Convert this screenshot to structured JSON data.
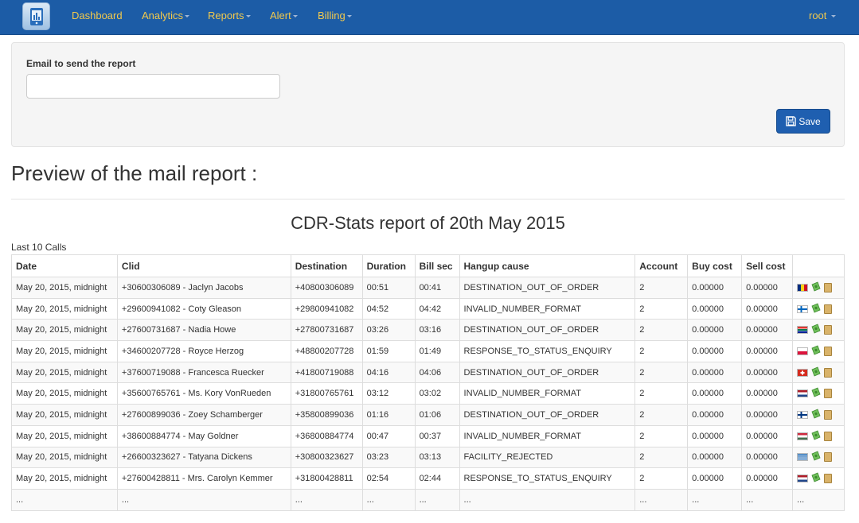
{
  "navbar": {
    "logo_icon": "phone-app-icon",
    "items": [
      {
        "label": "Dashboard",
        "dropdown": false
      },
      {
        "label": "Analytics",
        "dropdown": true
      },
      {
        "label": "Reports",
        "dropdown": true
      },
      {
        "label": "Alert",
        "dropdown": true
      },
      {
        "label": "Billing",
        "dropdown": true
      }
    ],
    "user": "root",
    "colors": {
      "background": "#1c5ca6",
      "link": "#f2c94c"
    }
  },
  "form": {
    "email_label": "Email to send the report",
    "email_value": "",
    "email_placeholder": "",
    "save_label": "Save",
    "save_icon": "floppy-disk-icon"
  },
  "preview_title": "Preview of the mail report :",
  "report": {
    "title": "CDR-Stats report of 20th May 2015",
    "section_label": "Last 10 Calls",
    "columns": [
      "Date",
      "Clid",
      "Destination",
      "Duration",
      "Bill sec",
      "Hangup cause",
      "Account",
      "Buy cost",
      "Sell cost",
      ""
    ],
    "rows": [
      {
        "date": "May 20, 2015, midnight",
        "clid": "+30600306089 - Jaclyn Jacobs",
        "destination": "+40800306089",
        "duration": "00:51",
        "billsec": "00:41",
        "hangup": "DESTINATION_OUT_OF_ORDER",
        "account": "2",
        "buy": "0.00000",
        "sell": "0.00000",
        "flag": "romania-flag"
      },
      {
        "date": "May 20, 2015, midnight",
        "clid": "+29600941082 - Coty Gleason",
        "destination": "+29800941082",
        "duration": "04:52",
        "billsec": "04:42",
        "hangup": "INVALID_NUMBER_FORMAT",
        "account": "2",
        "buy": "0.00000",
        "sell": "0.00000",
        "flag": "faroe-islands-flag"
      },
      {
        "date": "May 20, 2015, midnight",
        "clid": "+27600731687 - Nadia Howe",
        "destination": "+27800731687",
        "duration": "03:26",
        "billsec": "03:16",
        "hangup": "DESTINATION_OUT_OF_ORDER",
        "account": "2",
        "buy": "0.00000",
        "sell": "0.00000",
        "flag": "south-africa-flag"
      },
      {
        "date": "May 20, 2015, midnight",
        "clid": "+34600207728 - Royce Herzog",
        "destination": "+48800207728",
        "duration": "01:59",
        "billsec": "01:49",
        "hangup": "RESPONSE_TO_STATUS_ENQUIRY",
        "account": "2",
        "buy": "0.00000",
        "sell": "0.00000",
        "flag": "poland-flag"
      },
      {
        "date": "May 20, 2015, midnight",
        "clid": "+37600719088 - Francesca Ruecker",
        "destination": "+41800719088",
        "duration": "04:16",
        "billsec": "04:06",
        "hangup": "DESTINATION_OUT_OF_ORDER",
        "account": "2",
        "buy": "0.00000",
        "sell": "0.00000",
        "flag": "switzerland-flag"
      },
      {
        "date": "May 20, 2015, midnight",
        "clid": "+35600765761 - Ms. Kory VonRueden",
        "destination": "+31800765761",
        "duration": "03:12",
        "billsec": "03:02",
        "hangup": "INVALID_NUMBER_FORMAT",
        "account": "2",
        "buy": "0.00000",
        "sell": "0.00000",
        "flag": "netherlands-flag"
      },
      {
        "date": "May 20, 2015, midnight",
        "clid": "+27600899036 - Zoey Schamberger",
        "destination": "+35800899036",
        "duration": "01:16",
        "billsec": "01:06",
        "hangup": "DESTINATION_OUT_OF_ORDER",
        "account": "2",
        "buy": "0.00000",
        "sell": "0.00000",
        "flag": "finland-flag"
      },
      {
        "date": "May 20, 2015, midnight",
        "clid": "+38600884774 - May Goldner",
        "destination": "+36800884774",
        "duration": "00:47",
        "billsec": "00:37",
        "hangup": "INVALID_NUMBER_FORMAT",
        "account": "2",
        "buy": "0.00000",
        "sell": "0.00000",
        "flag": "hungary-flag"
      },
      {
        "date": "May 20, 2015, midnight",
        "clid": "+26600323627 - Tatyana Dickens",
        "destination": "+30800323627",
        "duration": "03:23",
        "billsec": "03:13",
        "hangup": "FACILITY_REJECTED",
        "account": "2",
        "buy": "0.00000",
        "sell": "0.00000",
        "flag": "greece-flag"
      },
      {
        "date": "May 20, 2015, midnight",
        "clid": "+27600428811 - Mrs. Carolyn Kemmer",
        "destination": "+31800428811",
        "duration": "02:54",
        "billsec": "02:44",
        "hangup": "RESPONSE_TO_STATUS_ENQUIRY",
        "account": "2",
        "buy": "0.00000",
        "sell": "0.00000",
        "flag": "netherlands-flag"
      }
    ],
    "ellipsis": "..."
  }
}
